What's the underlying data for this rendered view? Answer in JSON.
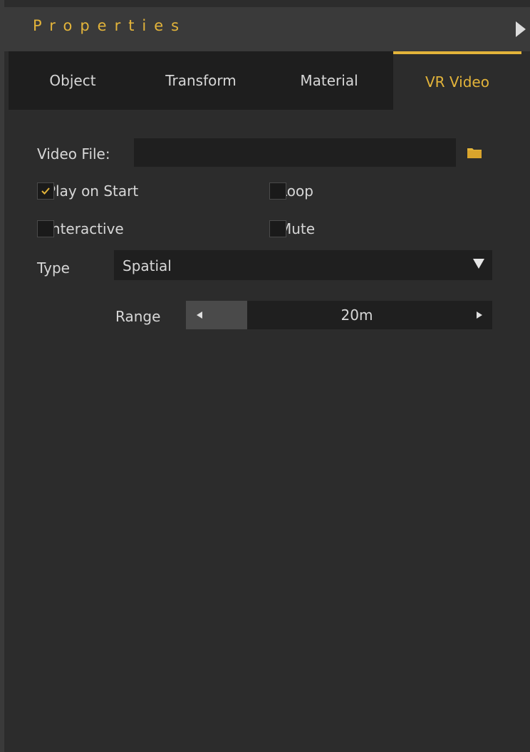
{
  "panel": {
    "title": "Properties",
    "accent_color": "#e3b43a",
    "collapse_icon": "play-right-icon"
  },
  "tabs": [
    {
      "label": "Object",
      "active": false
    },
    {
      "label": "Transform",
      "active": false
    },
    {
      "label": "Material",
      "active": false
    },
    {
      "label": "VR Video",
      "active": true
    }
  ],
  "vr_video": {
    "video_file_label": "Video File:",
    "video_file_value": "",
    "browse_icon": "folder-icon",
    "checkboxes": {
      "play_on_start": {
        "label": "Play on Start",
        "checked": true
      },
      "loop": {
        "label": "Loop",
        "checked": false
      },
      "interactive": {
        "label": "Interactive",
        "checked": false
      },
      "mute": {
        "label": "Mute",
        "checked": false
      }
    },
    "type_label": "Type",
    "type_value": "Spatial",
    "range_label": "Range",
    "range_value": "20m"
  }
}
